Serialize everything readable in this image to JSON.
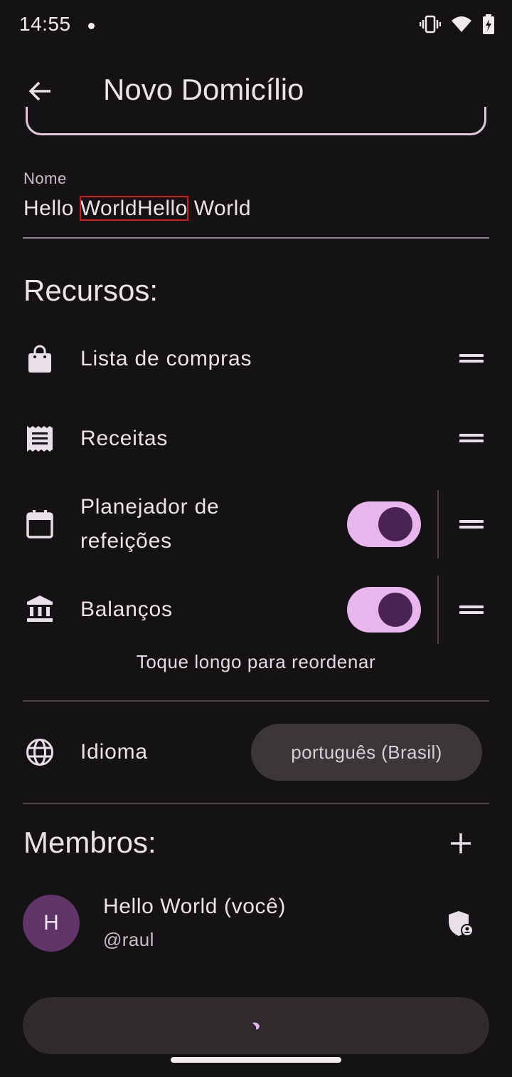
{
  "status_bar": {
    "time": "14:55"
  },
  "app_bar": {
    "title": "Novo Domicílio"
  },
  "name_field": {
    "label": "Nome",
    "value_before": "Hello ",
    "value_highlight": "WorldHello",
    "value_after": " World"
  },
  "resources": {
    "title": "Recursos:",
    "items": [
      {
        "label": "Lista de compras",
        "icon": "shopping-bag-icon"
      },
      {
        "label": "Receitas",
        "icon": "receipt-icon"
      },
      {
        "label": "Planejador de\nrefeições",
        "icon": "calendar-icon",
        "enabled": true
      },
      {
        "label": "Balanços",
        "icon": "bank-icon",
        "enabled": true
      }
    ],
    "hint": "Toque longo para reordenar"
  },
  "language": {
    "label": "Idioma",
    "value": "português (Brasil)",
    "icon": "globe-icon"
  },
  "members": {
    "title": "Membros:",
    "list": [
      {
        "initial": "H",
        "name": "Hello World (você)",
        "handle": "@raul"
      }
    ]
  },
  "colors": {
    "background": "#151215",
    "switch_track": "#e8b5ec",
    "switch_knob": "#4a2352",
    "avatar": "#5e3566",
    "highlight_box": "#d21b1b"
  }
}
